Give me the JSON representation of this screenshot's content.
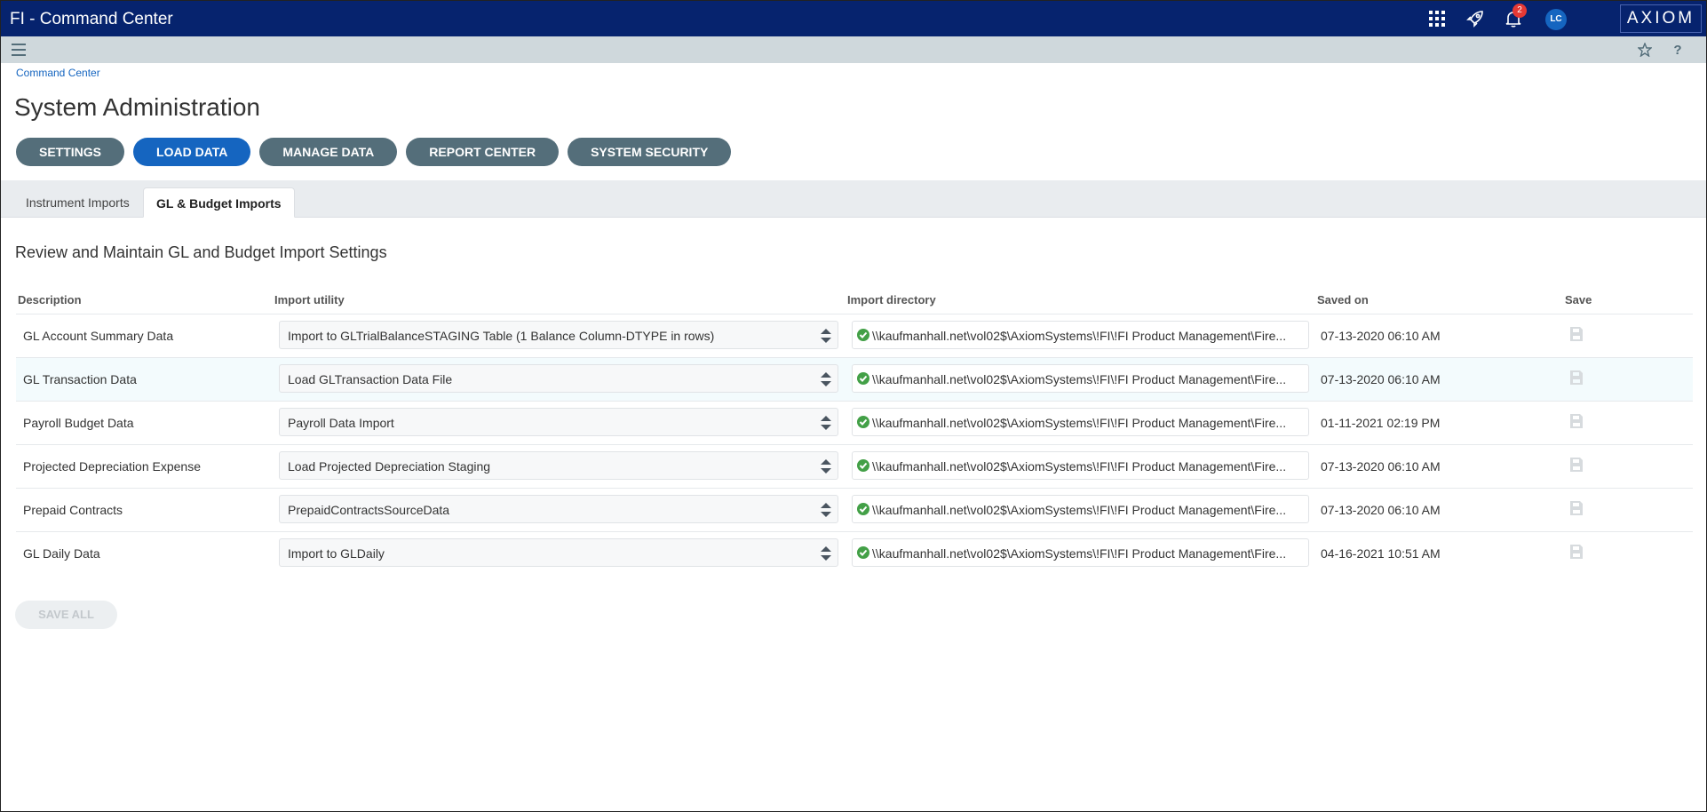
{
  "app": {
    "title": "FI - Command Center",
    "logo": "AXIOM",
    "avatar_initials": "LC",
    "notification_count": "2"
  },
  "breadcrumb": "Command Center",
  "page_title": "System Administration",
  "nav_buttons": [
    "SETTINGS",
    "LOAD DATA",
    "MANAGE DATA",
    "REPORT CENTER",
    "SYSTEM SECURITY"
  ],
  "tabs": [
    "Instrument Imports",
    "GL & Budget Imports"
  ],
  "section_title": "Review and Maintain GL and Budget Import Settings",
  "table": {
    "headers": [
      "Description",
      "Import utility",
      "Import directory",
      "Saved on",
      "Save"
    ],
    "rows": [
      {
        "description": "GL Account Summary Data",
        "utility": "Import to GLTrialBalanceSTAGING Table (1 Balance Column-DTYPE in rows)",
        "directory": "\\\\kaufmanhall.net\\vol02$\\AxiomSystems\\!FI\\!FI Product Management\\Fire...",
        "saved_on": "07-13-2020 06:10 AM"
      },
      {
        "description": "GL Transaction Data",
        "utility": "Load GLTransaction Data File",
        "directory": "\\\\kaufmanhall.net\\vol02$\\AxiomSystems\\!FI\\!FI Product Management\\Fire...",
        "saved_on": "07-13-2020 06:10 AM"
      },
      {
        "description": "Payroll Budget Data",
        "utility": "Payroll Data Import",
        "directory": "\\\\kaufmanhall.net\\vol02$\\AxiomSystems\\!FI\\!FI Product Management\\Fire...",
        "saved_on": "01-11-2021 02:19 PM"
      },
      {
        "description": "Projected Depreciation Expense",
        "utility": "Load Projected Depreciation Staging",
        "directory": "\\\\kaufmanhall.net\\vol02$\\AxiomSystems\\!FI\\!FI Product Management\\Fire...",
        "saved_on": "07-13-2020 06:10 AM"
      },
      {
        "description": "Prepaid Contracts",
        "utility": "PrepaidContractsSourceData",
        "directory": "\\\\kaufmanhall.net\\vol02$\\AxiomSystems\\!FI\\!FI Product Management\\Fire...",
        "saved_on": "07-13-2020 06:10 AM"
      },
      {
        "description": "GL Daily Data",
        "utility": "Import to GLDaily",
        "directory": "\\\\kaufmanhall.net\\vol02$\\AxiomSystems\\!FI\\!FI Product Management\\Fire...",
        "saved_on": "04-16-2021 10:51 AM"
      }
    ]
  },
  "save_all_label": "SAVE ALL",
  "colors": {
    "topbar": "#06236e",
    "active_button": "#1565c0",
    "button": "#546e7a",
    "badge": "#e53935",
    "status_ok": "#43a047"
  },
  "icons": [
    "apps-grid-icon",
    "rocket-icon",
    "bell-icon",
    "menu-icon",
    "star-icon",
    "help-icon",
    "check-circle-icon",
    "sort-arrows-icon",
    "save-icon"
  ]
}
